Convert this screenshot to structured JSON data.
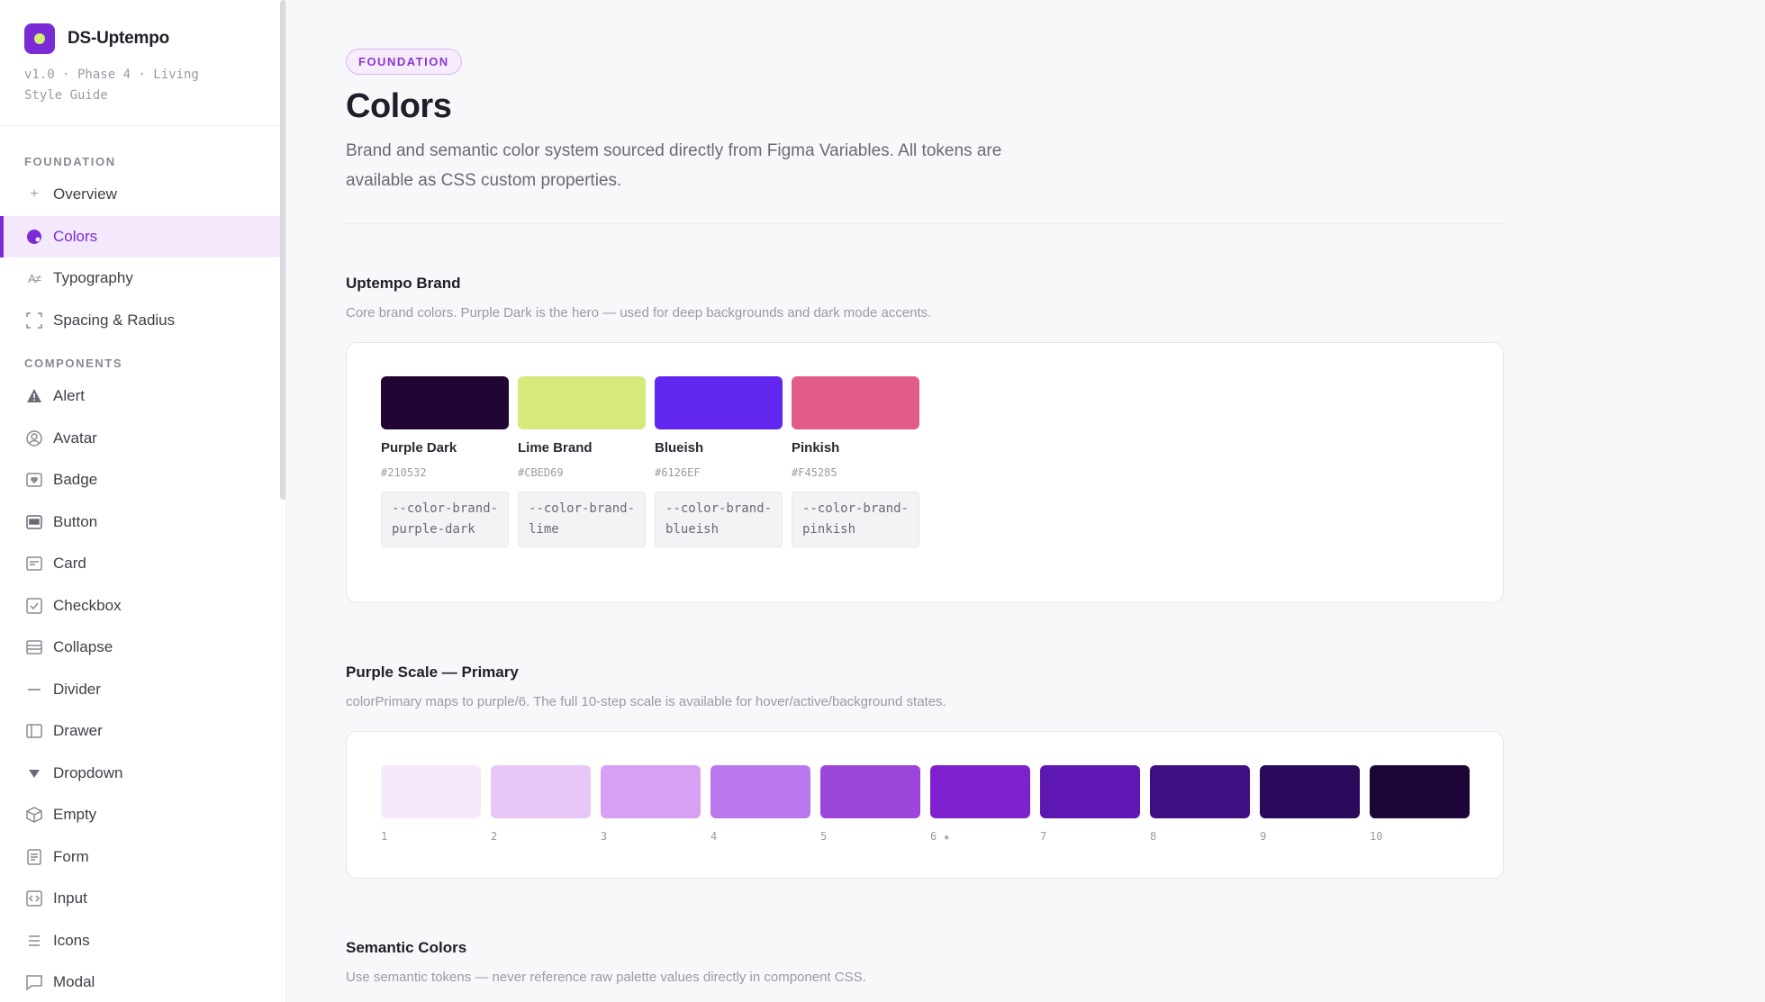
{
  "sidebar": {
    "brand_name": "DS-Uptempo",
    "version": "v1.0 · Phase 4 · Living Style Guide",
    "sections": {
      "foundation": "FOUNDATION",
      "components": "COMPONENTS"
    },
    "foundation_items": [
      {
        "label": "Overview",
        "icon": "plus-icon"
      },
      {
        "label": "Colors",
        "icon": "palette-icon",
        "active": true
      },
      {
        "label": "Typography",
        "icon": "typography-icon"
      },
      {
        "label": "Spacing & Radius",
        "icon": "spacing-icon"
      }
    ],
    "component_items": [
      {
        "label": "Alert",
        "icon": "warning-icon"
      },
      {
        "label": "Avatar",
        "icon": "user-circle-icon"
      },
      {
        "label": "Badge",
        "icon": "badge-icon"
      },
      {
        "label": "Button",
        "icon": "button-icon"
      },
      {
        "label": "Card",
        "icon": "card-icon"
      },
      {
        "label": "Checkbox",
        "icon": "checkbox-icon"
      },
      {
        "label": "Collapse",
        "icon": "collapse-icon"
      },
      {
        "label": "Divider",
        "icon": "divider-icon"
      },
      {
        "label": "Drawer",
        "icon": "drawer-icon"
      },
      {
        "label": "Dropdown",
        "icon": "caret-down-icon"
      },
      {
        "label": "Empty",
        "icon": "box-icon"
      },
      {
        "label": "Form",
        "icon": "form-icon"
      },
      {
        "label": "Input",
        "icon": "code-icon"
      },
      {
        "label": "Icons",
        "icon": "list-icon"
      },
      {
        "label": "Modal",
        "icon": "modal-icon"
      }
    ]
  },
  "header": {
    "badge": "FOUNDATION",
    "title": "Colors",
    "description": "Brand and semantic color system sourced directly from Figma Variables. All tokens are available as CSS custom properties."
  },
  "brand_section": {
    "title": "Uptempo Brand",
    "description": "Core brand colors. Purple Dark is the hero — used for deep backgrounds and dark mode accents.",
    "colors": [
      {
        "name": "Purple Dark",
        "hex": "#210532",
        "token": "--color-brand-purple-dark",
        "color": "#210532"
      },
      {
        "name": "Lime Brand",
        "hex": "#CBED69",
        "token": "--color-brand-lime",
        "color": "#d5ea7a"
      },
      {
        "name": "Blueish",
        "hex": "#6126EF",
        "token": "--color-brand-blueish",
        "color": "#6126ef"
      },
      {
        "name": "Pinkish",
        "hex": "#F45285",
        "token": "--color-brand-pinkish",
        "color": "#e15d87"
      }
    ]
  },
  "purple_section": {
    "title": "Purple Scale — Primary",
    "description": "colorPrimary maps to purple/6. The full 10-step scale is available for hover/active/background states.",
    "steps": [
      {
        "label": "1",
        "color": "#f5e9fc"
      },
      {
        "label": "2",
        "color": "#e8c7f7"
      },
      {
        "label": "3",
        "color": "#d7a0f2"
      },
      {
        "label": "4",
        "color": "#b977ec"
      },
      {
        "label": "5",
        "color": "#9b45db"
      },
      {
        "label": "6 ★",
        "color": "#7d21cf"
      },
      {
        "label": "7",
        "color": "#5f17b3"
      },
      {
        "label": "8",
        "color": "#3e0e83"
      },
      {
        "label": "9",
        "color": "#2a0a5a"
      },
      {
        "label": "10",
        "color": "#1c0638"
      }
    ]
  },
  "semantic_section": {
    "title": "Semantic Colors",
    "description": "Use semantic tokens — never reference raw palette values directly in component CSS."
  },
  "colors": {
    "accent": "#7b2bd6",
    "accent_bg": "#f4e8fd"
  }
}
